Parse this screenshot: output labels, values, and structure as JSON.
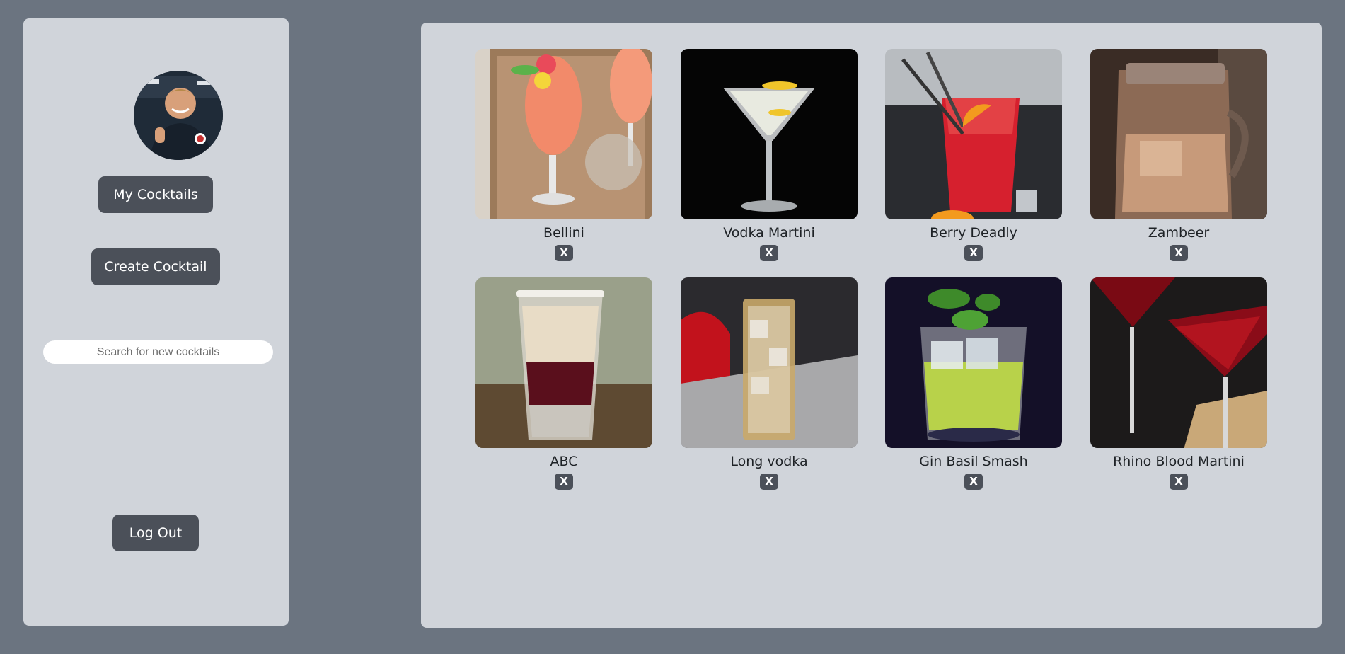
{
  "sidebar": {
    "my_cocktails_label": "My Cocktails",
    "create_cocktail_label": "Create Cocktail",
    "search_placeholder": "Search for new cocktails",
    "logout_label": "Log Out"
  },
  "cocktails": [
    {
      "name": "Bellini",
      "delete_label": "X"
    },
    {
      "name": "Vodka Martini",
      "delete_label": "X"
    },
    {
      "name": "Berry Deadly",
      "delete_label": "X"
    },
    {
      "name": "Zambeer",
      "delete_label": "X"
    },
    {
      "name": "ABC",
      "delete_label": "X"
    },
    {
      "name": "Long vodka",
      "delete_label": "X"
    },
    {
      "name": "Gin Basil Smash",
      "delete_label": "X"
    },
    {
      "name": "Rhino Blood Martini",
      "delete_label": "X"
    }
  ],
  "colors": {
    "page_bg": "#6b7480",
    "panel_bg": "#d0d4da",
    "button_bg": "#4b5059"
  }
}
